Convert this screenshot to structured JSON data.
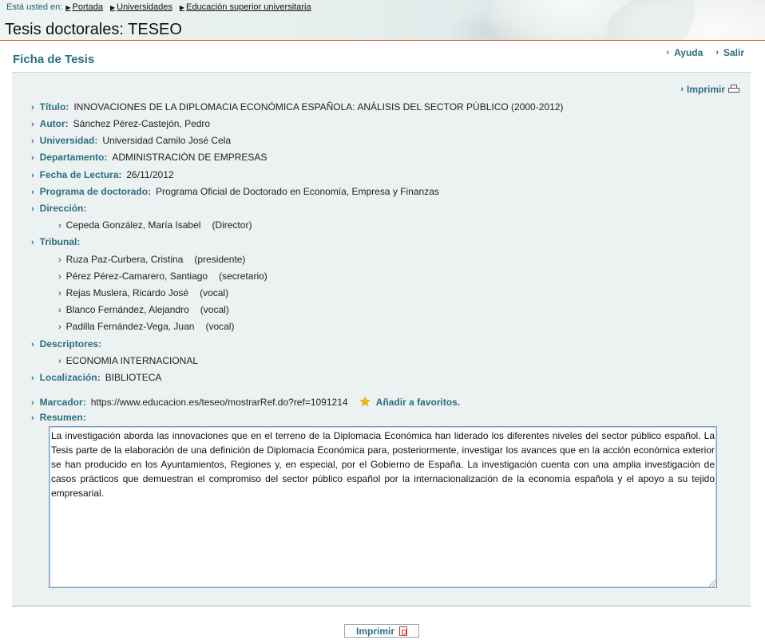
{
  "breadcrumb": {
    "prefix": "Está usted en:",
    "items": [
      {
        "label": "Portada"
      },
      {
        "label": "Universidades"
      },
      {
        "label": "Educación superior universitaria"
      }
    ]
  },
  "page_title": "Tesis doctorales: TESEO",
  "section_title": "Ficha de Tesis",
  "top_links": {
    "ayuda": "Ayuda",
    "salir": "Salir"
  },
  "print_label": "Imprimir",
  "fields": {
    "titulo": {
      "label": "Título:",
      "value": "INNOVACIONES DE LA DIPLOMACIA ECONÓMICA ESPAÑOLA: ANÁLISIS DEL SECTOR PÚBLICO (2000-2012)"
    },
    "autor": {
      "label": "Autor:",
      "value": "Sánchez Pérez-Castejón, Pedro"
    },
    "universidad": {
      "label": "Universidad:",
      "value": "Universidad Camilo José Cela"
    },
    "departamento": {
      "label": "Departamento:",
      "value": "ADMINISTRACIÓN DE EMPRESAS"
    },
    "fecha": {
      "label": "Fecha de Lectura:",
      "value": "26/11/2012"
    },
    "programa": {
      "label": "Programa de doctorado:",
      "value": "Programa Oficial de Doctorado en Economía, Empresa y Finanzas"
    },
    "direccion": {
      "label": "Dirección:",
      "items": [
        {
          "name": "Cepeda González, María Isabel",
          "role": "(Director)"
        }
      ]
    },
    "tribunal": {
      "label": "Tribunal:",
      "items": [
        {
          "name": "Ruza Paz-Curbera, Cristina",
          "role": "(presidente)"
        },
        {
          "name": "Pérez Pérez-Camarero, Santiago",
          "role": "(secretario)"
        },
        {
          "name": "Rejas Muslera, Ricardo José",
          "role": "(vocal)"
        },
        {
          "name": "Blanco Fernández, Alejandro",
          "role": "(vocal)"
        },
        {
          "name": "Padilla Fernández-Vega, Juan",
          "role": "(vocal)"
        }
      ]
    },
    "descriptores": {
      "label": "Descriptores:",
      "items": [
        "ECONOMIA INTERNACIONAL"
      ]
    },
    "localizacion": {
      "label": "Localización:",
      "value": "BIBLIOTECA"
    },
    "marcador": {
      "label": "Marcador:",
      "value": "https://www.educacion.es/teseo/mostrarRef.do?ref=1091214",
      "favorite_label": "Añadir a favoritos."
    },
    "resumen": {
      "label": "Resumen:",
      "text": "La investigación aborda las innovaciones que en el terreno de la Diplomacia Económica han liderado los diferentes niveles del sector público español. La Tesis parte de la elaboración de una definición de Diplomacia Económica para, posteriormente, investigar los avances que en la acción económica exterior se han producido en los Ayuntamientos, Regiones y, en especial, por el Gobierno de España. La investigación cuenta con una amplia investigación de casos prácticos que demuestran el compromiso del sector público español por la internacionalización de la economía española y el apoyo a su tejido empresarial."
    }
  },
  "colors": {
    "accent": "#2a6e80",
    "header_rule": "#d34a2a",
    "panel_bg": "#ecf2f1",
    "star": "#f0b400"
  }
}
